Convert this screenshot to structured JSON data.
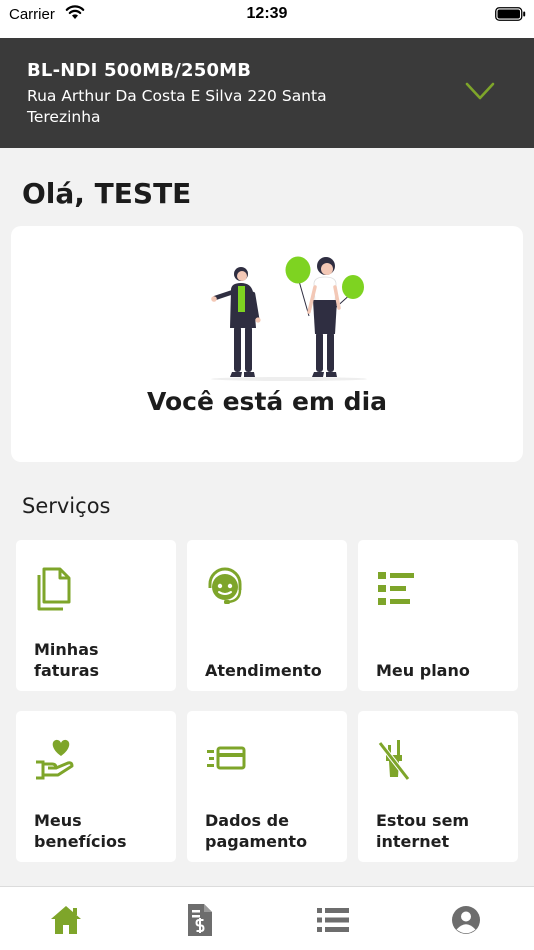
{
  "status_bar": {
    "carrier": "Carrier",
    "time": "12:39"
  },
  "header": {
    "plan_name": "BL-NDI 500MB/250MB",
    "address": "Rua Arthur Da Costa E Silva 220 Santa Terezinha"
  },
  "greeting": "Olá, TESTE",
  "status_message": "Você está em dia",
  "services": {
    "title": "Serviços",
    "items": [
      {
        "label": "Minhas faturas",
        "icon": "document-icon"
      },
      {
        "label": "Atendimento",
        "icon": "support-agent-icon"
      },
      {
        "label": "Meu plano",
        "icon": "list-icon"
      },
      {
        "label": "Meus benefícios",
        "icon": "heart-hand-icon"
      },
      {
        "label": "Dados de pagamento",
        "icon": "credit-card-icon"
      },
      {
        "label": "Estou sem internet",
        "icon": "no-signal-icon"
      }
    ]
  },
  "tabs": [
    {
      "icon": "home-icon",
      "active": true
    },
    {
      "icon": "invoice-icon",
      "active": false
    },
    {
      "icon": "list-icon",
      "active": false
    },
    {
      "icon": "profile-icon",
      "active": false
    }
  ],
  "colors": {
    "accent": "#7ea52a",
    "header_bg": "#3a3a3a",
    "tab_inactive": "#6d6d6d"
  }
}
